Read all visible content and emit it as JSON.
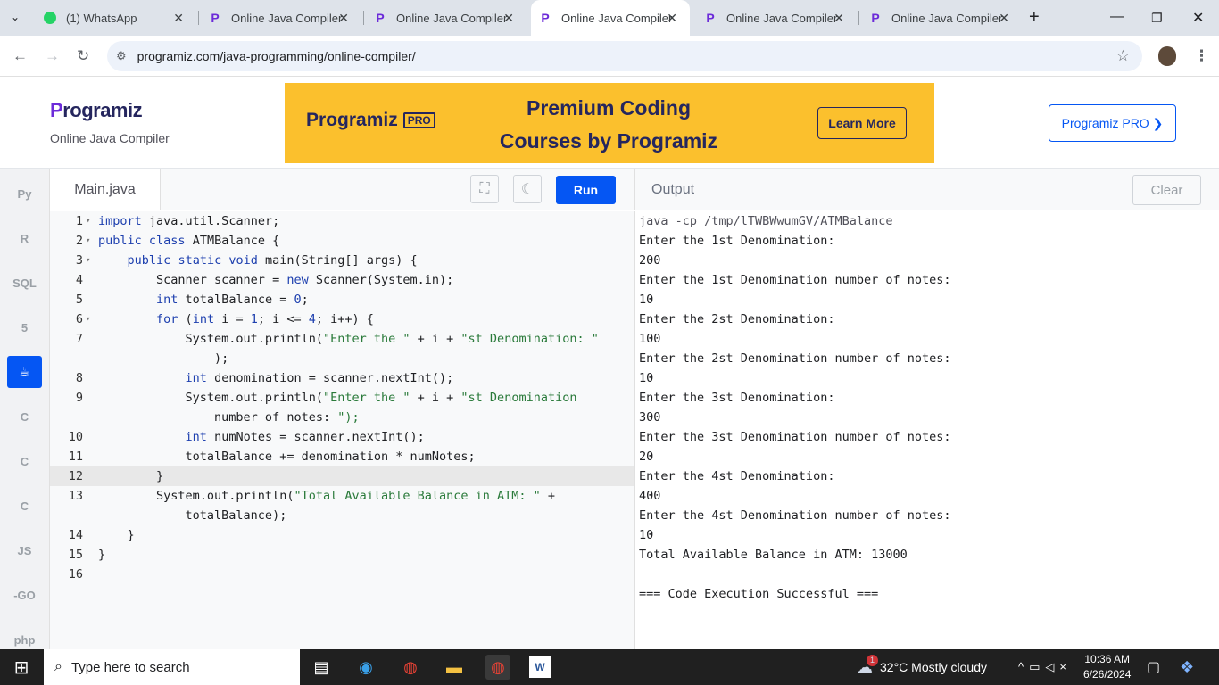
{
  "browser": {
    "tabs": [
      {
        "label": "(1) WhatsApp",
        "icon": "whatsapp-icon"
      },
      {
        "label": "Online Java Compiler",
        "icon": "programiz-icon"
      },
      {
        "label": "Online Java Compiler",
        "icon": "programiz-icon"
      },
      {
        "label": "Online Java Compiler",
        "icon": "programiz-icon",
        "active": true
      },
      {
        "label": "Online Java Compiler",
        "icon": "programiz-icon"
      },
      {
        "label": "Online Java Compiler",
        "icon": "programiz-icon"
      }
    ],
    "url": "programiz.com/java-programming/online-compiler/"
  },
  "header": {
    "logo": "rogramiz",
    "logo_p": "P",
    "subtitle": "Online Java Compiler",
    "banner": {
      "logo": "rogramiz",
      "logo_p": "P",
      "badge": "PRO",
      "line1": "Premium Coding",
      "line2": "Courses by Programiz",
      "cta": "Learn More"
    },
    "pro_button": "Programiz PRO ❯"
  },
  "sidebar": {
    "items": [
      {
        "name": "python",
        "label": "Py"
      },
      {
        "name": "r",
        "label": "R"
      },
      {
        "name": "sql",
        "label": "SQL"
      },
      {
        "name": "html",
        "label": "5"
      },
      {
        "name": "java",
        "label": "☕",
        "active": true
      },
      {
        "name": "c",
        "label": "C"
      },
      {
        "name": "cpp",
        "label": "C"
      },
      {
        "name": "csharp",
        "label": "C"
      },
      {
        "name": "js",
        "label": "JS"
      },
      {
        "name": "go",
        "label": "-GO"
      },
      {
        "name": "php",
        "label": "php"
      }
    ]
  },
  "editor": {
    "file_tab": "Main.java",
    "run_label": "Run",
    "lines": [
      {
        "num": "1",
        "fold": "▾",
        "code": "import java.util.Scanner;"
      },
      {
        "num": "2",
        "fold": "▾",
        "code": "public class ATMBalance {"
      },
      {
        "num": "3",
        "fold": "▾",
        "code": "    public static void main(String[] args) {"
      },
      {
        "num": "4",
        "fold": "",
        "code": "        Scanner scanner = new Scanner(System.in);"
      },
      {
        "num": "5",
        "fold": "",
        "code": "        int totalBalance = 0;"
      },
      {
        "num": "6",
        "fold": "▾",
        "code": "        for (int i = 1; i <= 4; i++) {"
      },
      {
        "num": "7",
        "fold": "",
        "code": "            System.out.println(\"Enter the \" + i + \"st Denomination: \""
      },
      {
        "num": "",
        "fold": "",
        "code": "                );"
      },
      {
        "num": "8",
        "fold": "",
        "code": "            int denomination = scanner.nextInt();"
      },
      {
        "num": "9",
        "fold": "",
        "code": "            System.out.println(\"Enter the \" + i + \"st Denomination"
      },
      {
        "num": "",
        "fold": "",
        "code": "                number of notes: \");"
      },
      {
        "num": "10",
        "fold": "",
        "code": "            int numNotes = scanner.nextInt();"
      },
      {
        "num": "11",
        "fold": "",
        "code": "            totalBalance += denomination * numNotes;"
      },
      {
        "num": "12",
        "fold": "",
        "code": "        }"
      },
      {
        "num": "13",
        "fold": "",
        "code": "        System.out.println(\"Total Available Balance in ATM: \" +"
      },
      {
        "num": "",
        "fold": "",
        "code": "            totalBalance);"
      },
      {
        "num": "14",
        "fold": "",
        "code": "    }"
      },
      {
        "num": "15",
        "fold": "",
        "code": "}"
      },
      {
        "num": "16",
        "fold": "",
        "code": ""
      }
    ]
  },
  "output": {
    "title": "Output",
    "clear_label": "Clear",
    "lines": [
      "java -cp /tmp/lTWBWwumGV/ATMBalance",
      "Enter the 1st Denomination:",
      "200",
      "Enter the 1st Denomination number of notes:",
      "10",
      "Enter the 2st Denomination:",
      "100",
      "Enter the 2st Denomination number of notes:",
      "10",
      "Enter the 3st Denomination:",
      "300",
      "Enter the 3st Denomination number of notes:",
      "20",
      "Enter the 4st Denomination:",
      "400",
      "Enter the 4st Denomination number of notes:",
      "10",
      "Total Available Balance in ATM: 13000",
      "",
      "=== Code Execution Successful ==="
    ]
  },
  "taskbar": {
    "search_placeholder": "Type here to search",
    "weather": "32°C  Mostly cloudy",
    "weather_badge": "1",
    "time": "10:36 AM",
    "date": "6/26/2024"
  },
  "colors": {
    "accent": "#0556f3",
    "banner": "#fbc02d",
    "brand": "#25265e"
  }
}
